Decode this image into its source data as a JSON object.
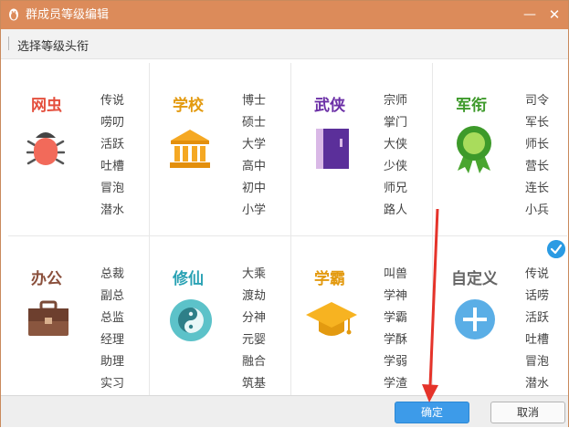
{
  "window": {
    "title": "群成员等级编辑",
    "minimize_glyph": "—",
    "close_glyph": "✕"
  },
  "subheader": {
    "label": "选择等级头衔"
  },
  "categories": [
    {
      "title": "网虫",
      "icon": "bug-icon",
      "color": "#e44f3d",
      "levels": [
        "传说",
        "唠叨",
        "活跃",
        "吐槽",
        "冒泡",
        "潜水"
      ]
    },
    {
      "title": "学校",
      "icon": "school-building-icon",
      "color": "#e39a10",
      "levels": [
        "博士",
        "硕士",
        "大学",
        "高中",
        "初中",
        "小学"
      ]
    },
    {
      "title": "武侠",
      "icon": "book-icon",
      "color": "#6b2fa6",
      "levels": [
        "宗师",
        "掌门",
        "大侠",
        "少侠",
        "师兄",
        "路人"
      ]
    },
    {
      "title": "军衔",
      "icon": "medal-icon",
      "color": "#3e9a2b",
      "levels": [
        "司令",
        "军长",
        "师长",
        "营长",
        "连长",
        "小兵"
      ]
    },
    {
      "title": "办公",
      "icon": "briefcase-icon",
      "color": "#8a4f3b",
      "levels": [
        "总裁",
        "副总",
        "总监",
        "经理",
        "助理",
        "实习"
      ]
    },
    {
      "title": "修仙",
      "icon": "yin-yang-icon",
      "color": "#2aa2b4",
      "levels": [
        "大乘",
        "渡劫",
        "分神",
        "元婴",
        "融合",
        "筑基"
      ]
    },
    {
      "title": "学霸",
      "icon": "graduation-cap-icon",
      "color": "#e39a10",
      "levels": [
        "叫兽",
        "学神",
        "学霸",
        "学酥",
        "学弱",
        "学渣"
      ]
    },
    {
      "title": "自定义",
      "icon": "plus-circle-icon",
      "color": "#666666",
      "levels": [
        "传说",
        "话唠",
        "活跃",
        "吐槽",
        "冒泡",
        "潜水"
      ]
    }
  ],
  "selected_category": "自定义",
  "footer": {
    "ok_label": "确定",
    "cancel_label": "取消"
  },
  "colors": {
    "titlebar": "#dc8b5a",
    "accent": "#3d9be9",
    "arrow": "#e5332a"
  }
}
